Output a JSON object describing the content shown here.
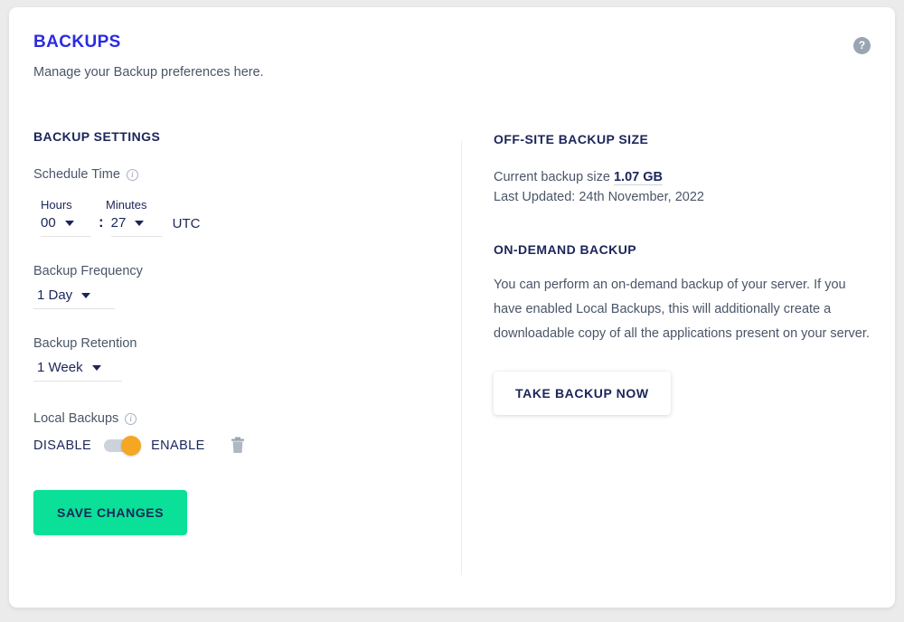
{
  "header": {
    "title": "BACKUPS",
    "subtitle": "Manage your Backup preferences here.",
    "help_icon_glyph": "?"
  },
  "colors": {
    "title": "#2b2be0",
    "heading": "#1b2559",
    "body_text": "#4a5568",
    "save_button_bg": "#0ae098",
    "toggle_knob": "#f5a623",
    "toggle_track": "#cdd3dc",
    "page_background": "#ebebeb",
    "card_background": "#ffffff"
  },
  "backup_settings": {
    "heading": "BACKUP SETTINGS",
    "schedule_time": {
      "label": "Schedule Time",
      "info_icon": "info-icon",
      "hours_label": "Hours",
      "minutes_label": "Minutes",
      "hours_value": "00",
      "minutes_value": "27",
      "separator": ":",
      "timezone": "UTC"
    },
    "backup_frequency": {
      "label": "Backup Frequency",
      "value": "1 Day"
    },
    "backup_retention": {
      "label": "Backup Retention",
      "value": "1 Week"
    },
    "local_backups": {
      "label": "Local Backups",
      "info_icon": "info-icon",
      "disable_label": "DISABLE",
      "enable_label": "ENABLE",
      "state": "ENABLE",
      "delete_icon": "trash-icon"
    },
    "save_button": "SAVE CHANGES"
  },
  "offsite_backup": {
    "heading": "OFF-SITE BACKUP SIZE",
    "current_size_label": "Current backup size",
    "current_size_value": "1.07 GB",
    "last_updated": "Last Updated: 24th November, 2022"
  },
  "on_demand_backup": {
    "heading": "ON-DEMAND BACKUP",
    "description": "You can perform an on-demand backup of your server. If you have enabled Local Backups, this will additionally create a downloadable copy of all the applications present on your server.",
    "button": "TAKE BACKUP NOW"
  }
}
